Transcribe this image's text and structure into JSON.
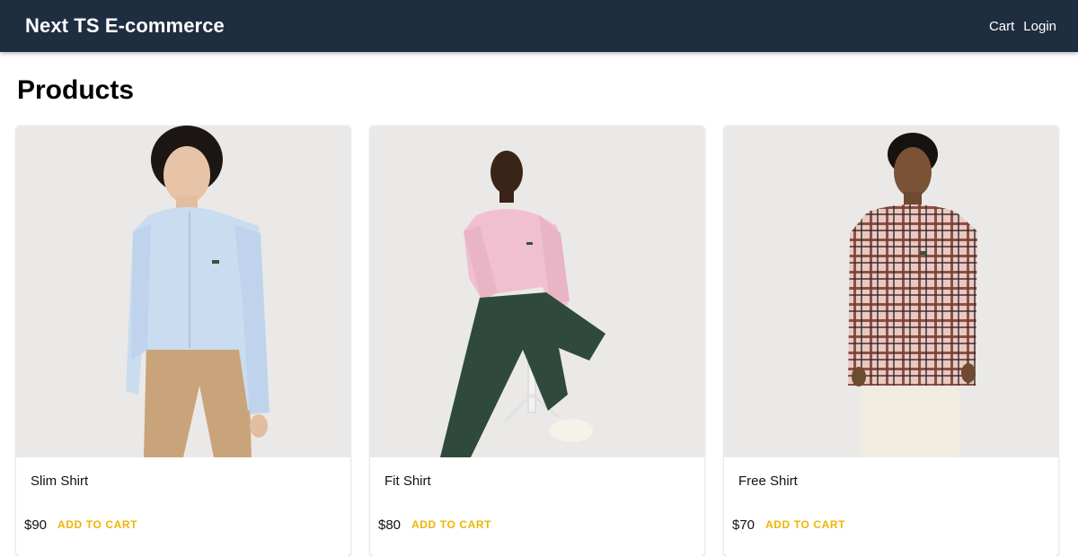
{
  "header": {
    "title": "Next TS E-commerce",
    "nav": [
      {
        "label": "Cart"
      },
      {
        "label": "Login"
      }
    ],
    "background": "#1f2d40"
  },
  "main": {
    "title": "Products"
  },
  "products": [
    {
      "name": "Slim Shirt",
      "price": "$90",
      "action": "ADD TO CART",
      "shirt_color": "#c9dcf0",
      "pants_color": "#c9a47a"
    },
    {
      "name": "Fit Shirt",
      "price": "$80",
      "action": "ADD TO CART",
      "shirt_color": "#f0c0d0",
      "pants_color": "#2f4a3c"
    },
    {
      "name": "Free Shirt",
      "price": "$70",
      "action": "ADD TO CART",
      "shirt_color": "#d8a0a0",
      "pants_color": "#f0ece0"
    }
  ],
  "colors": {
    "accent": "#f0b400"
  }
}
